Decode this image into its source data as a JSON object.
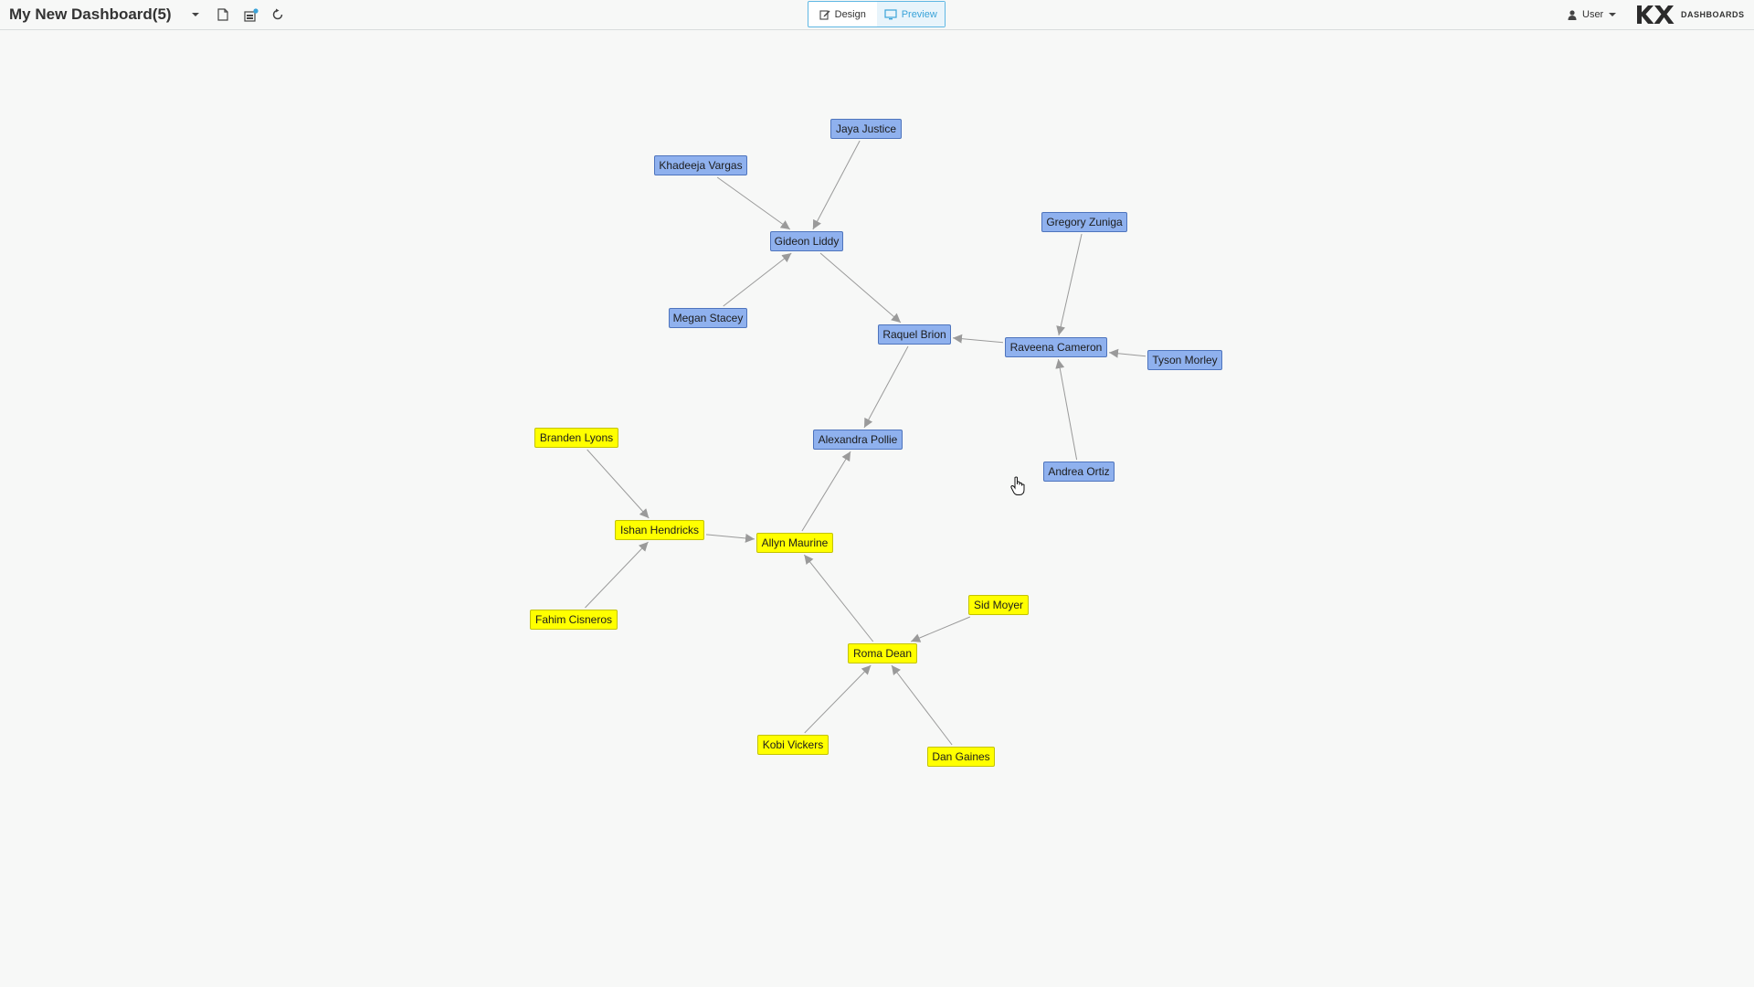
{
  "header": {
    "title": "My New Dashboard(5)",
    "design_label": "Design",
    "preview_label": "Preview",
    "user_label": "User",
    "brand_name": "DASHBOARDS"
  },
  "colors": {
    "group_a_fill": "#8fb1ee",
    "group_a_border": "#4e74bd",
    "group_b_fill": "#ffff00",
    "group_b_border": "#c3c300",
    "edge": "#9a9a9a",
    "accent": "#3aa3d9"
  },
  "graph": {
    "nodes": [
      {
        "id": "jaya",
        "label": "Jaya Justice",
        "group": "blue"
      },
      {
        "id": "khadeeja",
        "label": "Khadeeja Vargas",
        "group": "blue"
      },
      {
        "id": "gideon",
        "label": "Gideon Liddy",
        "group": "blue"
      },
      {
        "id": "megan",
        "label": "Megan Stacey",
        "group": "blue"
      },
      {
        "id": "gregory",
        "label": "Gregory Zuniga",
        "group": "blue"
      },
      {
        "id": "raquel",
        "label": "Raquel Brion",
        "group": "blue"
      },
      {
        "id": "raveena",
        "label": "Raveena Cameron",
        "group": "blue"
      },
      {
        "id": "tyson",
        "label": "Tyson Morley",
        "group": "blue"
      },
      {
        "id": "alexandra",
        "label": "Alexandra Pollie",
        "group": "blue"
      },
      {
        "id": "andrea",
        "label": "Andrea Ortiz",
        "group": "blue"
      },
      {
        "id": "branden",
        "label": "Branden Lyons",
        "group": "yellow"
      },
      {
        "id": "ishan",
        "label": "Ishan Hendricks",
        "group": "yellow"
      },
      {
        "id": "allyn",
        "label": "Allyn Maurine",
        "group": "yellow"
      },
      {
        "id": "fahim",
        "label": "Fahim Cisneros",
        "group": "yellow"
      },
      {
        "id": "sid",
        "label": "Sid Moyer",
        "group": "yellow"
      },
      {
        "id": "roma",
        "label": "Roma Dean",
        "group": "yellow"
      },
      {
        "id": "kobi",
        "label": "Kobi Vickers",
        "group": "yellow"
      },
      {
        "id": "dan",
        "label": "Dan Gaines",
        "group": "yellow"
      }
    ],
    "edges": [
      {
        "from": "jaya",
        "to": "gideon"
      },
      {
        "from": "khadeeja",
        "to": "gideon"
      },
      {
        "from": "megan",
        "to": "gideon"
      },
      {
        "from": "gideon",
        "to": "raquel"
      },
      {
        "from": "raveena",
        "to": "raquel"
      },
      {
        "from": "gregory",
        "to": "raveena"
      },
      {
        "from": "tyson",
        "to": "raveena"
      },
      {
        "from": "andrea",
        "to": "raveena"
      },
      {
        "from": "raquel",
        "to": "alexandra"
      },
      {
        "from": "allyn",
        "to": "alexandra"
      },
      {
        "from": "branden",
        "to": "ishan"
      },
      {
        "from": "fahim",
        "to": "ishan"
      },
      {
        "from": "ishan",
        "to": "allyn"
      },
      {
        "from": "roma",
        "to": "allyn"
      },
      {
        "from": "sid",
        "to": "roma"
      },
      {
        "from": "kobi",
        "to": "roma"
      },
      {
        "from": "dan",
        "to": "roma"
      }
    ]
  }
}
